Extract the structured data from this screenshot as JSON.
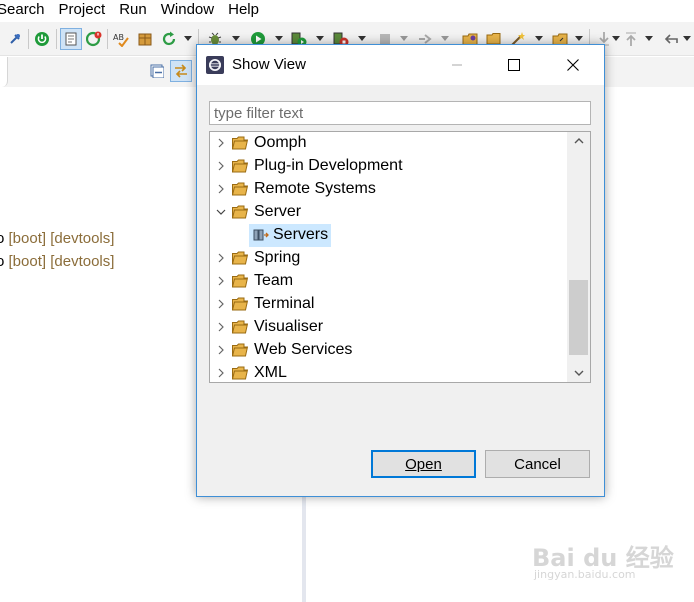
{
  "menubar": {
    "items": [
      "Search",
      "Project",
      "Run",
      "Window",
      "Help"
    ]
  },
  "console": {
    "lines": [
      {
        "prefix": "o",
        "tags": "[boot] [devtools]"
      },
      {
        "prefix": "o",
        "tags": "[boot] [devtools]"
      }
    ]
  },
  "dialog": {
    "title": "Show View",
    "filter": {
      "value": "",
      "placeholder": "type filter text"
    },
    "tree": [
      {
        "label": "Oomph",
        "expanded": false,
        "depth": 0,
        "icon": "folder-icon"
      },
      {
        "label": "Plug-in Development",
        "expanded": false,
        "depth": 0,
        "icon": "folder-icon"
      },
      {
        "label": "Remote Systems",
        "expanded": false,
        "depth": 0,
        "icon": "folder-icon"
      },
      {
        "label": "Server",
        "expanded": true,
        "depth": 0,
        "icon": "folder-icon"
      },
      {
        "label": "Servers",
        "depth": 1,
        "selected": true,
        "icon": "servers-view-icon"
      },
      {
        "label": "Spring",
        "expanded": false,
        "depth": 0,
        "icon": "folder-icon"
      },
      {
        "label": "Team",
        "expanded": false,
        "depth": 0,
        "icon": "folder-icon"
      },
      {
        "label": "Terminal",
        "expanded": false,
        "depth": 0,
        "icon": "folder-icon"
      },
      {
        "label": "Visualiser",
        "expanded": false,
        "depth": 0,
        "icon": "folder-icon"
      },
      {
        "label": "Web Services",
        "expanded": false,
        "depth": 0,
        "icon": "folder-icon"
      },
      {
        "label": "XML",
        "expanded": false,
        "depth": 0,
        "icon": "folder-icon"
      }
    ],
    "buttons": {
      "open": "Open",
      "cancel": "Cancel"
    }
  },
  "watermark": {
    "main": "Bai du 经验",
    "sub": "jingyan.baidu.com"
  },
  "colors": {
    "accent": "#0078d7",
    "selection": "#cce8ff",
    "folder": "#e8b44a",
    "console_tag": "#8b6d3a"
  }
}
